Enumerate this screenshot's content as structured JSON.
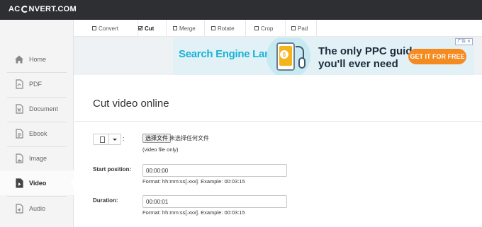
{
  "header": {
    "logo_prefix": "AC",
    "logo_suffix": "NVERT.COM"
  },
  "sidebar": {
    "items": [
      {
        "label": "Home",
        "icon": "home-icon"
      },
      {
        "label": "PDF",
        "icon": "pdf-icon"
      },
      {
        "label": "Document",
        "icon": "document-icon"
      },
      {
        "label": "Ebook",
        "icon": "ebook-icon"
      },
      {
        "label": "Image",
        "icon": "image-icon"
      },
      {
        "label": "Video",
        "icon": "video-icon",
        "active": true
      },
      {
        "label": "Audio",
        "icon": "audio-icon"
      }
    ]
  },
  "tabs": [
    {
      "label": "Convert"
    },
    {
      "label": "Cut",
      "active": true
    },
    {
      "label": "Merge"
    },
    {
      "label": "Rotate"
    },
    {
      "label": "Crop"
    },
    {
      "label": "Pad"
    }
  ],
  "ad": {
    "brand": "Search Engine Land",
    "line1": "The only PPC guide",
    "line2": "you'll ever need",
    "cta": "GET IT FOR FREE",
    "badge": "广告 ✕",
    "dollar": "$",
    "colors": {
      "brand": "#19b3d6",
      "cta": "#f58a1f",
      "screen": "#f5b31c"
    }
  },
  "main": {
    "title": "Cut video online",
    "file": {
      "colon": ":",
      "choose_label": "选择文件",
      "no_file_text": "未选择任何文件",
      "hint": "(video file only)"
    },
    "start": {
      "label": "Start position:",
      "value": "00:00:00",
      "hint": "Format: hh:mm:ss[.xxx]. Example: 00:03:15"
    },
    "duration": {
      "label": "Duration:",
      "value": "00:00:01",
      "hint": "Format: hh:mm:ss[.xxx]. Example: 00:03:15"
    }
  }
}
